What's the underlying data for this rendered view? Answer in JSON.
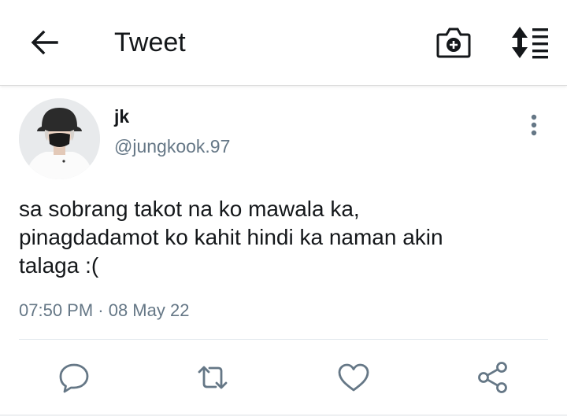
{
  "header": {
    "title": "Tweet",
    "icons": {
      "back": "arrow-left-icon",
      "camera": "camera-add-icon",
      "sort": "sort-list-icon"
    }
  },
  "tweet": {
    "author_name": "jk",
    "author_handle": "@jungkook.97",
    "text_lines": [
      "sa sobrang takot na ko mawala ka,",
      "pinagdadamot ko kahit hindi ka naman akin",
      "talaga :("
    ],
    "timestamp": "07:50 PM · 08 May 22"
  },
  "actions": [
    {
      "name": "reply",
      "icon": "reply-icon"
    },
    {
      "name": "retweet",
      "icon": "retweet-icon"
    },
    {
      "name": "like",
      "icon": "heart-icon"
    },
    {
      "name": "share",
      "icon": "share-icon"
    }
  ],
  "colors": {
    "text_primary": "#14171a",
    "text_secondary": "#657786",
    "icon_gray": "#657786",
    "divider": "#e1e8ed"
  }
}
